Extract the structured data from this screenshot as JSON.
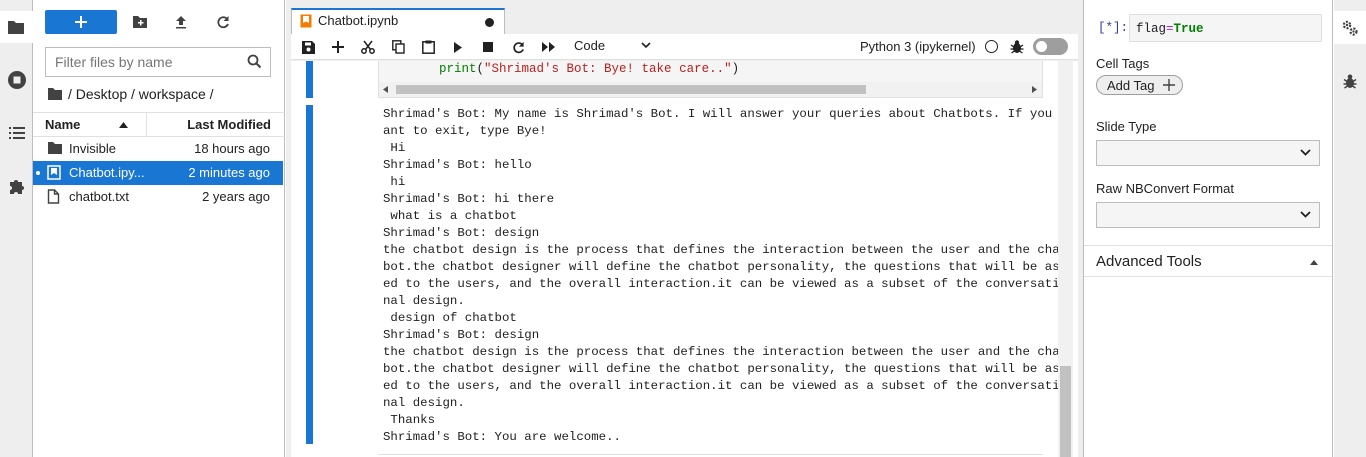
{
  "left_sidebar": {
    "items": [
      {
        "name": "file-browser",
        "icon": "folder-icon",
        "active": true
      },
      {
        "name": "running-terminals-kernels",
        "icon": "stop-circle-icon",
        "active": false
      },
      {
        "name": "table-of-contents",
        "icon": "list-icon",
        "active": false
      },
      {
        "name": "extension-manager",
        "icon": "puzzle-icon",
        "active": false
      }
    ]
  },
  "file_browser": {
    "new_label": "+",
    "filter_placeholder": "Filter files by name",
    "breadcrumb": "/ Desktop / workspace /",
    "columns": {
      "name": "Name",
      "modified": "Last Modified"
    },
    "files": [
      {
        "name": "Invisible",
        "modified": "18 hours ago",
        "type": "folder",
        "selected": false
      },
      {
        "name": "Chatbot.ipy...",
        "modified": "2 minutes ago",
        "type": "notebook",
        "selected": true
      },
      {
        "name": "chatbot.txt",
        "modified": "2 years ago",
        "type": "file",
        "selected": false
      }
    ]
  },
  "notebook": {
    "tab_title": "Chatbot.ipynb",
    "cell_type": "Code",
    "kernel_name": "Python 3 (ipykernel)",
    "code_line": {
      "indent": "",
      "fn": "print",
      "args_open": "(",
      "string": "\"Shrimad's Bot: Bye! take care..\"",
      "args_close": ")"
    },
    "output_lines": [
      "Shrimad's Bot: My name is Shrimad's Bot. I will answer your queries about Chatbots. If you w",
      "ant to exit, type Bye!",
      " Hi",
      "Shrimad's Bot: hello",
      " hi",
      "Shrimad's Bot: hi there",
      " what is a chatbot",
      "Shrimad's Bot: design",
      "the chatbot design is the process that defines the interaction between the user and the chat",
      "bot.the chatbot designer will define the chatbot personality, the questions that will be ask",
      "ed to the users, and the overall interaction.it can be viewed as a subset of the conversatio",
      "nal design.",
      " design of chatbot",
      "Shrimad's Bot: design",
      "the chatbot design is the process that defines the interaction between the user and the chat",
      "bot.the chatbot designer will define the chatbot personality, the questions that will be ask",
      "ed to the users, and the overall interaction.it can be viewed as a subset of the conversatio",
      "nal design.",
      " Thanks",
      "Shrimad's Bot: You are welcome.."
    ]
  },
  "inspector": {
    "prompt": "[*]:",
    "metadata_key": "flag",
    "metadata_eq": "=",
    "metadata_value": "True",
    "cell_tags_label": "Cell Tags",
    "add_tag_label": "Add Tag",
    "slide_type_label": "Slide Type",
    "raw_format_label": "Raw NBConvert Format",
    "advanced_tools_label": "Advanced Tools"
  },
  "right_sidebar": {
    "items": [
      {
        "name": "property-inspector",
        "icon": "gears-icon",
        "active": true
      },
      {
        "name": "debugger",
        "icon": "bug-icon",
        "active": false
      }
    ]
  },
  "colors": {
    "accent": "#1976d2",
    "string": "#ba2121",
    "builtin": "#008000",
    "prompt": "#303f9f"
  }
}
